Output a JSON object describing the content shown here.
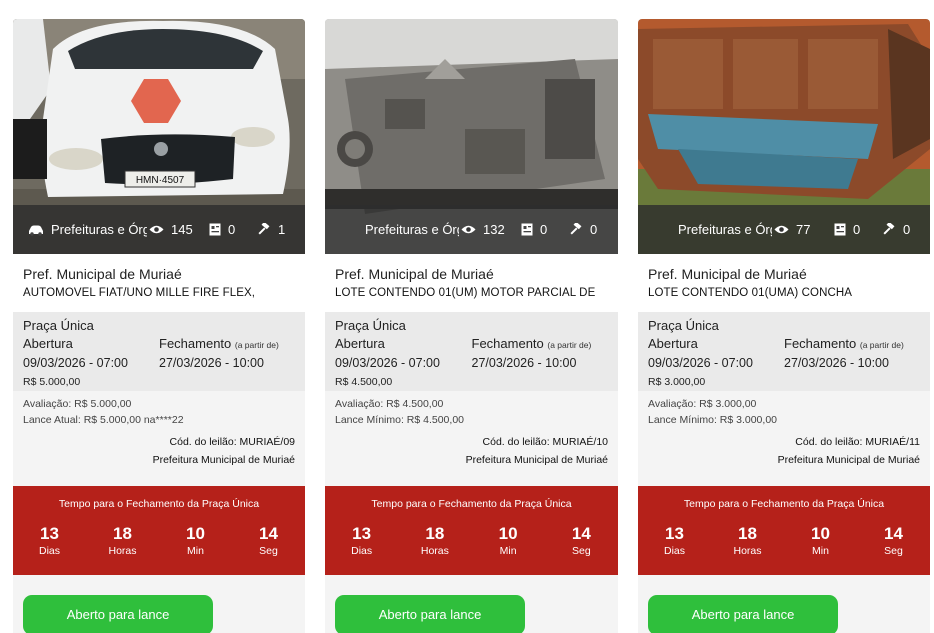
{
  "colors": {
    "stat_bar": "#2d2d2d",
    "timer_bg": "#b5211a",
    "button_bg": "#2fbf3c",
    "card_bg": "#f4f4f4",
    "dates_bg": "#eaeaea"
  },
  "cards": [
    {
      "category": "Prefeituras e Órgãos",
      "views": "145",
      "bids_icon_count": "0",
      "lances_count": "1",
      "org": "Pref. Municipal de Muriaé",
      "description": "AUTOMOVEL FIAT/UNO MILLE FIRE FLEX,",
      "praca": "Praça Única",
      "abertura_label": "Abertura",
      "abertura": "09/03/2026 - 07:00",
      "fechamento_label": "Fechamento",
      "fechamento_note": "(a partir de)",
      "fechamento": "27/03/2026 - 10:00",
      "price": "R$ 5.000,00",
      "avaliacao": "Avaliação: R$ 5.000,00",
      "lance": "Lance Atual: R$ 5.000,00 na****22",
      "codigo": "Cód. do leilão: MURIAÉ/09",
      "comitente": "Prefeitura Municipal de Muriaé",
      "timer_title": "Tempo para o Fechamento da Praça Única",
      "days": "13",
      "days_label": "Dias",
      "hours": "18",
      "hours_label": "Horas",
      "mins": "10",
      "mins_label": "Min",
      "secs": "14",
      "secs_label": "Seg",
      "button": "Aberto para lance"
    },
    {
      "category": "Prefeituras e Órgãos",
      "views": "132",
      "bids_icon_count": "0",
      "lances_count": "0",
      "org": "Pref. Municipal de Muriaé",
      "description": "LOTE CONTENDO 01(UM) MOTOR PARCIAL DE",
      "praca": "Praça Única",
      "abertura_label": "Abertura",
      "abertura": "09/03/2026 - 07:00",
      "fechamento_label": "Fechamento",
      "fechamento_note": "(a partir de)",
      "fechamento": "27/03/2026 - 10:00",
      "price": "R$ 4.500,00",
      "avaliacao": "Avaliação: R$ 4.500,00",
      "lance": "Lance Mínimo: R$ 4.500,00",
      "codigo": "Cód. do leilão: MURIAÉ/10",
      "comitente": "Prefeitura Municipal de Muriaé",
      "timer_title": "Tempo para o Fechamento da Praça Única",
      "days": "13",
      "days_label": "Dias",
      "hours": "18",
      "hours_label": "Horas",
      "mins": "10",
      "mins_label": "Min",
      "secs": "14",
      "secs_label": "Seg",
      "button": "Aberto para lance"
    },
    {
      "category": "Prefeituras e Órgãos",
      "views": "77",
      "bids_icon_count": "0",
      "lances_count": "0",
      "org": "Pref. Municipal de Muriaé",
      "description": "LOTE CONTENDO 01(UMA) CONCHA",
      "praca": "Praça Única",
      "abertura_label": "Abertura",
      "abertura": "09/03/2026 - 07:00",
      "fechamento_label": "Fechamento",
      "fechamento_note": "(a partir de)",
      "fechamento": "27/03/2026 - 10:00",
      "price": "R$ 3.000,00",
      "avaliacao": "Avaliação: R$ 3.000,00",
      "lance": "Lance Mínimo: R$ 3.000,00",
      "codigo": "Cód. do leilão: MURIAÉ/11",
      "comitente": "Prefeitura Municipal de Muriaé",
      "timer_title": "Tempo para o Fechamento da Praça Única",
      "days": "13",
      "days_label": "Dias",
      "hours": "18",
      "hours_label": "Horas",
      "mins": "10",
      "mins_label": "Min",
      "secs": "14",
      "secs_label": "Seg",
      "button": "Aberto para lance"
    }
  ]
}
